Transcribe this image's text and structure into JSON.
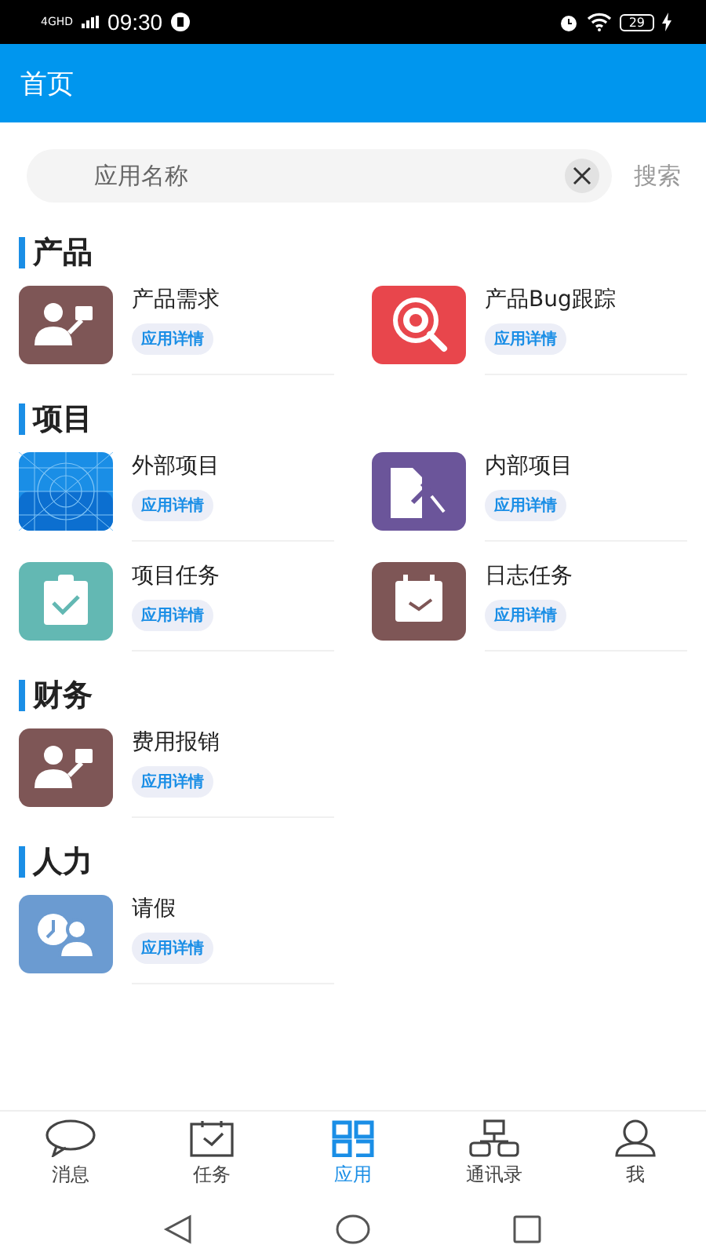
{
  "status_bar": {
    "network": "4GHD",
    "time": "09:30",
    "battery": "29"
  },
  "header": {
    "title": "首页"
  },
  "search": {
    "placeholder": "应用名称",
    "button": "搜索"
  },
  "sections": [
    {
      "title": "产品",
      "apps": [
        {
          "name": "产品需求",
          "tag": "应用详情",
          "kind": "presenter",
          "color": "#7e5656"
        },
        {
          "name": "产品Bug跟踪",
          "tag": "应用详情",
          "kind": "bug",
          "color": "#e8464c"
        }
      ]
    },
    {
      "title": "项目",
      "apps": [
        {
          "name": "外部项目",
          "tag": "应用详情",
          "kind": "blueprint",
          "color": "#1a8ee6"
        },
        {
          "name": "内部项目",
          "tag": "应用详情",
          "kind": "document",
          "color": "#6b559a"
        },
        {
          "name": "项目任务",
          "tag": "应用详情",
          "kind": "clipboard",
          "color": "#63b8b3"
        },
        {
          "name": "日志任务",
          "tag": "应用详情",
          "kind": "calendar",
          "color": "#7e5656"
        }
      ]
    },
    {
      "title": "财务",
      "apps": [
        {
          "name": "费用报销",
          "tag": "应用详情",
          "kind": "presenter",
          "color": "#7e5656"
        }
      ]
    },
    {
      "title": "人力",
      "apps": [
        {
          "name": "请假",
          "tag": "应用详情",
          "kind": "leave",
          "color": "#6b9bd1"
        }
      ]
    }
  ],
  "tabs": [
    {
      "label": "消息",
      "kind": "chat",
      "selected": false
    },
    {
      "label": "任务",
      "kind": "task",
      "selected": false
    },
    {
      "label": "应用",
      "kind": "apps",
      "selected": true
    },
    {
      "label": "通讯录",
      "kind": "org",
      "selected": false
    },
    {
      "label": "我",
      "kind": "me",
      "selected": false
    }
  ]
}
